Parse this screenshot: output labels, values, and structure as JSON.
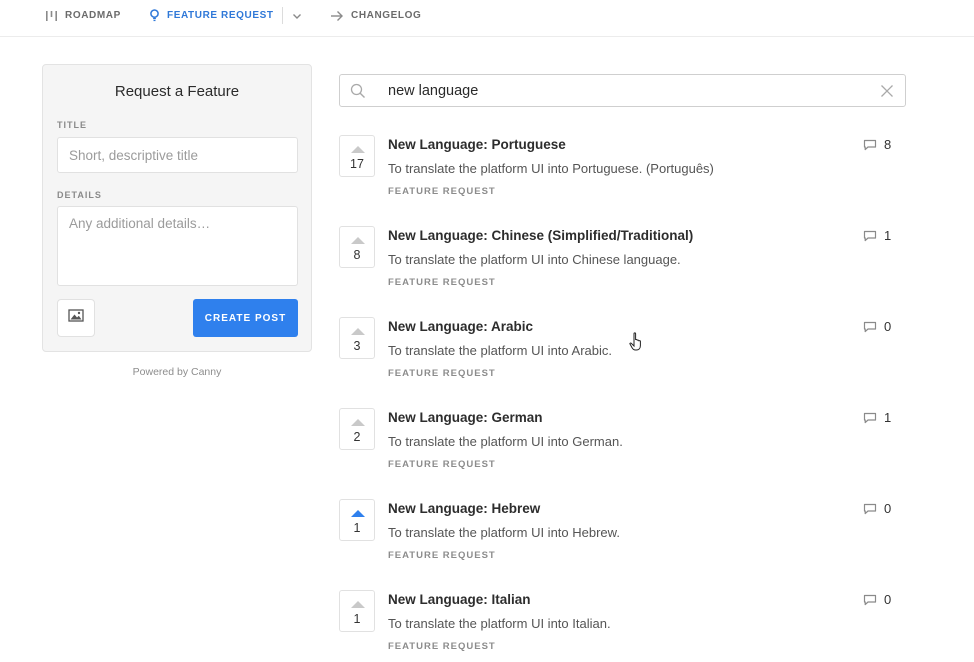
{
  "nav": {
    "roadmap": "ROADMAP",
    "feature_request": "FEATURE REQUEST",
    "changelog": "CHANGELOG",
    "active_color": "#2f78d8"
  },
  "request_form": {
    "heading": "Request a Feature",
    "title_label": "TITLE",
    "title_placeholder": "Short, descriptive title",
    "title_value": "",
    "details_label": "DETAILS",
    "details_placeholder": "Any additional details…",
    "details_value": "",
    "image_button_icon": "image-icon",
    "create_button": "CREATE POST",
    "button_color": "#2f80ed",
    "powered_by": "Powered by Canny"
  },
  "search": {
    "value": "new language",
    "icon": "search-icon",
    "clear_icon": "close-icon"
  },
  "posts": [
    {
      "title": "New Language: Portuguese",
      "description": "To translate the platform UI into Portuguese. (Português)",
      "tag": "FEATURE REQUEST",
      "votes": "17",
      "comments": "8",
      "voted": false
    },
    {
      "title": "New Language: Chinese (Simplified/Traditional)",
      "description": "To translate the platform UI into Chinese language.",
      "tag": "FEATURE REQUEST",
      "votes": "8",
      "comments": "1",
      "voted": false
    },
    {
      "title": "New Language: Arabic",
      "description": "To translate the platform UI into Arabic.",
      "tag": "FEATURE REQUEST",
      "votes": "3",
      "comments": "0",
      "voted": false
    },
    {
      "title": "New Language: German",
      "description": "To translate the platform UI into German.",
      "tag": "FEATURE REQUEST",
      "votes": "2",
      "comments": "1",
      "voted": false
    },
    {
      "title": "New Language: Hebrew",
      "description": "To translate the platform UI into Hebrew.",
      "tag": "FEATURE REQUEST",
      "votes": "1",
      "comments": "0",
      "voted": true
    },
    {
      "title": "New Language: Italian",
      "description": "To translate the platform UI into Italian.",
      "tag": "FEATURE REQUEST",
      "votes": "1",
      "comments": "0",
      "voted": false
    }
  ]
}
